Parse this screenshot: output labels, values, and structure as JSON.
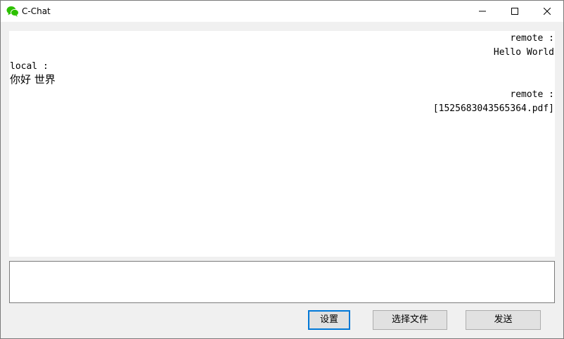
{
  "window": {
    "title": "C-Chat",
    "app_icon": "wechat-logo-icon",
    "controls": {
      "minimize_icon": "minimize-icon",
      "maximize_icon": "maximize-icon",
      "close_icon": "close-icon"
    }
  },
  "chat": {
    "messages": [
      {
        "sender": "remote :",
        "text": "Hello World",
        "align": "right"
      },
      {
        "sender": "local :",
        "text": "你好 世界",
        "align": "left"
      },
      {
        "sender": "remote :",
        "text": "[1525683043565364.pdf]",
        "align": "right"
      }
    ]
  },
  "input": {
    "value": ""
  },
  "buttons": {
    "settings_label": "设置",
    "choose_file_label": "选择文件",
    "send_label": "发送"
  },
  "colors": {
    "accent": "#0078d7",
    "app_icon": "#2dc100",
    "button_face": "#e1e1e1"
  }
}
